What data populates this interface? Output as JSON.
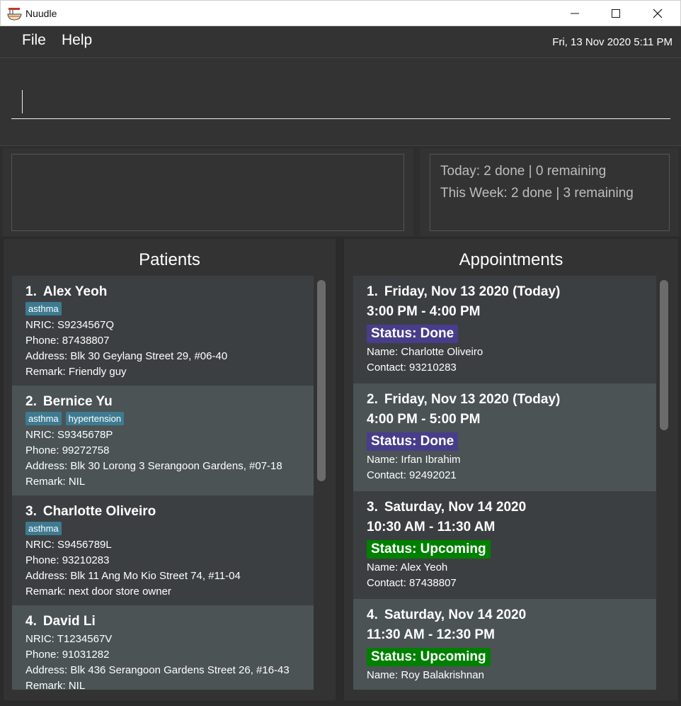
{
  "window": {
    "title": "Nuudle",
    "icon": "noodle-bowl-icon"
  },
  "menu": {
    "file_label": "File",
    "help_label": "Help",
    "datetime": "Fri, 13 Nov 2020 5:11 PM"
  },
  "command": {
    "value": "",
    "placeholder": ""
  },
  "stats": {
    "today": "Today: 2 done | 0 remaining",
    "week": "This Week: 2 done | 3 remaining"
  },
  "patients": {
    "header": "Patients",
    "items": [
      {
        "index": "1.",
        "name": "Alex Yeoh",
        "tags": [
          "asthma"
        ],
        "nric": "NRIC: S9234567Q",
        "phone": "Phone: 87438807",
        "address": "Address: Blk 30 Geylang Street 29, #06-40",
        "remark": "Remark: Friendly guy"
      },
      {
        "index": "2.",
        "name": "Bernice Yu",
        "tags": [
          "asthma",
          "hypertension"
        ],
        "nric": "NRIC: S9345678P",
        "phone": "Phone: 99272758",
        "address": "Address: Blk 30 Lorong 3 Serangoon Gardens, #07-18",
        "remark": "Remark: NIL"
      },
      {
        "index": "3.",
        "name": "Charlotte Oliveiro",
        "tags": [
          "asthma"
        ],
        "nric": "NRIC: S9456789L",
        "phone": "Phone: 93210283",
        "address": "Address: Blk 11 Ang Mo Kio Street 74, #11-04",
        "remark": "Remark: next door store owner"
      },
      {
        "index": "4.",
        "name": "David Li",
        "tags": [],
        "nric": "NRIC: T1234567V",
        "phone": "Phone: 91031282",
        "address": "Address: Blk 436 Serangoon Gardens Street 26, #16-43",
        "remark": "Remark: NIL"
      }
    ]
  },
  "appointments": {
    "header": "Appointments",
    "items": [
      {
        "index": "1.",
        "date": "Friday, Nov 13 2020 (Today)",
        "time": "3:00 PM - 4:00 PM",
        "status": "Status: Done",
        "name": "Name: Charlotte Oliveiro",
        "contact": "Contact: 93210283"
      },
      {
        "index": "2.",
        "date": "Friday, Nov 13 2020 (Today)",
        "time": "4:00 PM - 5:00 PM",
        "status": "Status: Done",
        "name": "Name: Irfan Ibrahim",
        "contact": "Contact: 92492021"
      },
      {
        "index": "3.",
        "date": "Saturday, Nov 14 2020",
        "time": "10:30 AM - 11:30 AM",
        "status": "Status: Upcoming",
        "name": "Name: Alex Yeoh",
        "contact": "Contact: 87438807"
      },
      {
        "index": "4.",
        "date": "Saturday, Nov 14 2020",
        "time": "11:30 AM - 12:30 PM",
        "status": "Status: Upcoming",
        "name": "Name: Roy Balakrishnan",
        "contact": ""
      }
    ]
  },
  "colors": {
    "background": "#2b2b2b",
    "panel": "#333333",
    "tag": "#3e7b91",
    "status_done": "#483d8b",
    "status_upcoming": "#008000"
  }
}
